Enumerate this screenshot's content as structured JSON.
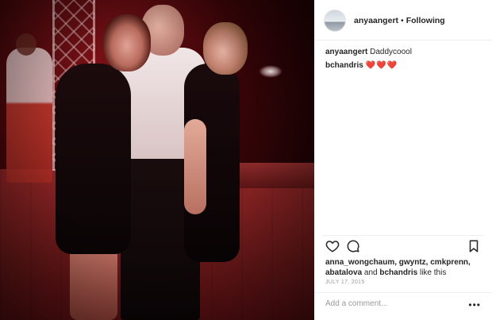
{
  "post": {
    "author": "anyaangert",
    "separator": "•",
    "follow_status": "Following",
    "comments": [
      {
        "user": "anyaangert",
        "text": "Daddycoool"
      },
      {
        "user": "bchandris",
        "text": "❤️❤️❤️"
      }
    ],
    "likes": {
      "users_line_1": "anna_wongchaum, gwyntz, cmkprenn,",
      "users_line_2_a": "abatalova",
      "and": "and",
      "users_line_2_b": "bchandris",
      "suffix": "like this"
    },
    "date": "JULY 17, 2015",
    "add_comment_placeholder": "Add a comment...",
    "more_label": "•••"
  },
  "icons": {
    "like": "heart-icon",
    "comment": "comment-bubble-icon",
    "save": "bookmark-icon",
    "more": "more-options-icon"
  },
  "colors": {
    "hearts": "#e0245e",
    "text": "#262626",
    "muted": "#999999"
  }
}
